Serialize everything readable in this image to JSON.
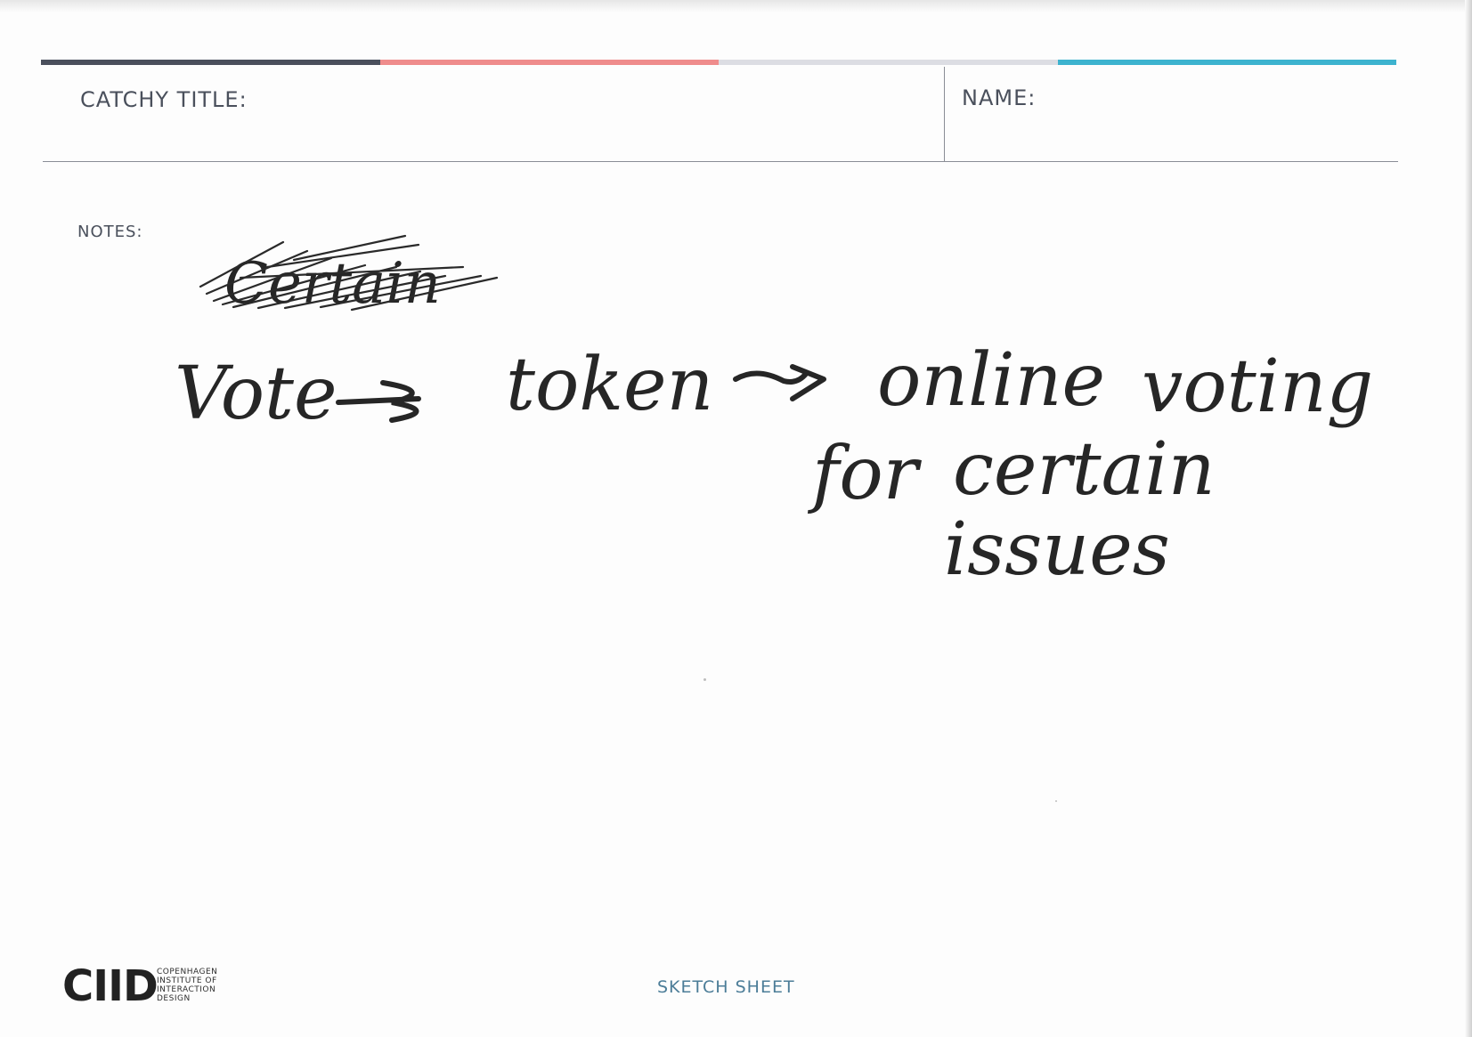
{
  "sheet": {
    "header": {
      "title_label": "CATCHY TITLE:",
      "name_label": "NAME:",
      "color_bar": [
        "#4a4f5c",
        "#ef8c8c",
        "#dcdde3",
        "#3db3cf"
      ]
    },
    "notes_label": "NOTES:",
    "handwriting": {
      "crossed_out": "Certain",
      "line1_word1": "Vote",
      "line1_word2": "token",
      "line1_word3": "online",
      "line1_word4": "voting",
      "line2_word1": "for",
      "line2_word2": "certain",
      "line3_word1": "issues"
    },
    "footer": {
      "logo_mark": "CIID",
      "logo_lines": [
        "COPENHAGEN",
        "INSTITUTE OF",
        "INTERACTION",
        "DESIGN"
      ],
      "sheet_label": "SKETCH SHEET"
    }
  }
}
